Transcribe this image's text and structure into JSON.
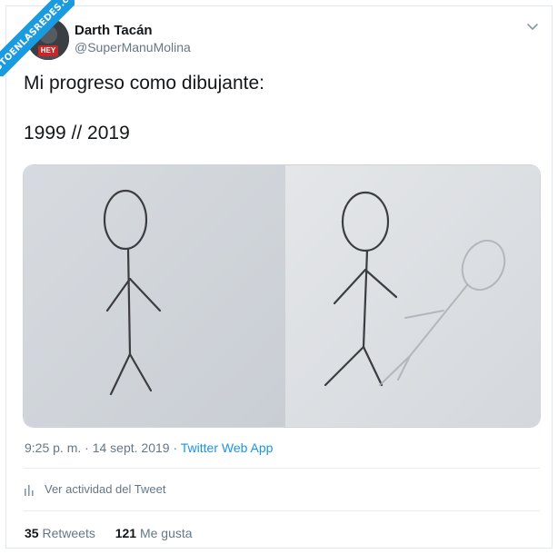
{
  "watermark": {
    "text": "VISTOENLASREDES.com"
  },
  "tweet": {
    "author_name": "Darth Tacán",
    "author_handle": "@SuperManuMolina",
    "avatar_badge": "HEY",
    "text_line1": "Mi progreso como dibujante:",
    "text_line2": "1999 // 2019",
    "time": "9:25 p. m.",
    "date": "14 sept. 2019",
    "separator": "·",
    "source": "Twitter Web App",
    "activity_label": "Ver actividad del Tweet",
    "retweets_count": "35",
    "retweets_label": "Retweets",
    "likes_count": "121",
    "likes_label": "Me gusta"
  },
  "icons": {
    "menu": "chevron-down-icon",
    "activity": "bar-chart-icon"
  },
  "colors": {
    "link": "#1b95e0",
    "muted": "#657786",
    "watermark": "#1a9be0"
  }
}
